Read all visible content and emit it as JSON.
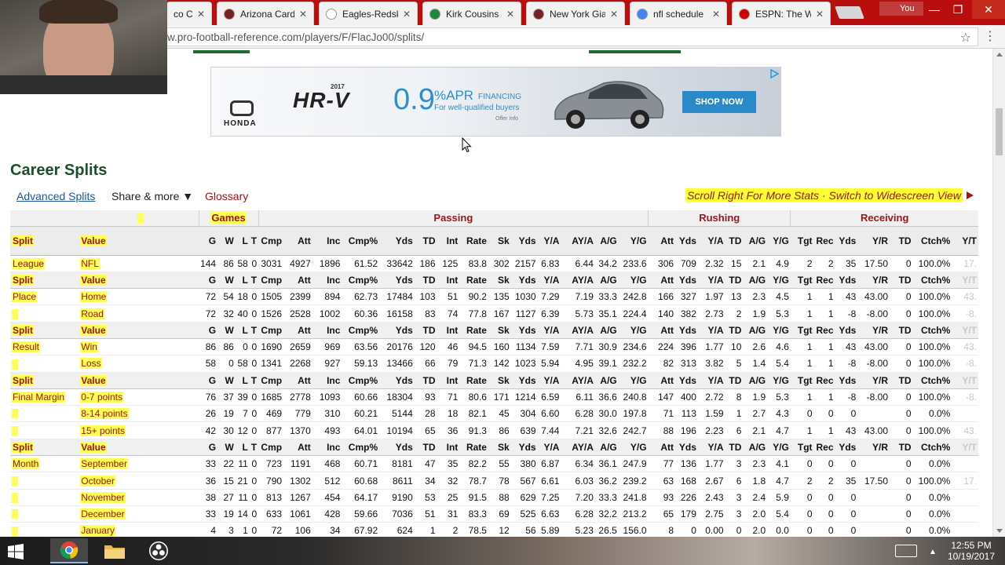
{
  "browser": {
    "tabs": [
      {
        "title": "co Ca",
        "favicon_color": "#8b5a2b"
      },
      {
        "title": "Arizona Card",
        "favicon_color": "#7a1f1f"
      },
      {
        "title": "Eagles-Redsk",
        "favicon_color": "#ffffff"
      },
      {
        "title": "Kirk Cousins",
        "favicon_color": "#1a8a3a"
      },
      {
        "title": "New York Gia",
        "favicon_color": "#7a1f1f"
      },
      {
        "title": "nfl schedule",
        "favicon_color": "#4285f4"
      },
      {
        "title": "ESPN: The W",
        "favicon_color": "#d00000"
      }
    ],
    "close_glyph": "✕",
    "user_label": "You",
    "url": "w.pro-football-reference.com/players/F/FlacJo00/splits/",
    "window_buttons": [
      "—",
      "❐",
      "✕"
    ]
  },
  "ad": {
    "brand": "HONDA",
    "year": "2017",
    "model": "HR-V",
    "rate": "0.9",
    "apr": "%APR",
    "financing": "FINANCING",
    "qualified": "For well-qualified buyers",
    "offer": "Offer Info",
    "cta": "SHOP NOW"
  },
  "page": {
    "title": "Career Splits",
    "advanced_link": "Advanced Splits",
    "share_menu": "Share & more ▼",
    "glossary": "Glossary",
    "scroll_hint": "Scroll Right For More Stats · Switch to Widescreen View"
  },
  "table": {
    "groups": [
      {
        "label": "",
        "span": 2
      },
      {
        "label": "Games",
        "span": 4
      },
      {
        "label": "Passing",
        "span": 14
      },
      {
        "label": "Rushing",
        "span": 6
      },
      {
        "label": "Receiving",
        "span": 8
      }
    ],
    "columns": [
      "Split",
      "Value",
      "G",
      "W",
      "L",
      "T",
      "Cmp",
      "Att",
      "Inc",
      "Cmp%",
      "Yds",
      "TD",
      "Int",
      "Rate",
      "Sk",
      "Yds",
      "Y/A",
      "AY/A",
      "A/G",
      "Y/G",
      "Att",
      "Yds",
      "Y/A",
      "TD",
      "A/G",
      "Y/G",
      "Tgt",
      "Rec",
      "Yds",
      "Y/R",
      "TD",
      "Ctch%",
      "Y/T"
    ],
    "rows": [
      {
        "type": "data",
        "split": "League",
        "value": "NFL",
        "cells": [
          "144",
          "86",
          "58",
          "0",
          "3031",
          "4927",
          "1896",
          "61.52",
          "33642",
          "186",
          "125",
          "83.8",
          "302",
          "2157",
          "6.83",
          "6.44",
          "34.2",
          "233.6",
          "306",
          "709",
          "2.32",
          "15",
          "2.1",
          "4.9",
          "2",
          "2",
          "35",
          "17.50",
          "0",
          "100.0%",
          "17."
        ]
      },
      {
        "type": "header"
      },
      {
        "type": "data",
        "split": "Place",
        "value": "Home",
        "cells": [
          "72",
          "54",
          "18",
          "0",
          "1505",
          "2399",
          "894",
          "62.73",
          "17484",
          "103",
          "51",
          "90.2",
          "135",
          "1030",
          "7.29",
          "7.19",
          "33.3",
          "242.8",
          "166",
          "327",
          "1.97",
          "13",
          "2.3",
          "4.5",
          "1",
          "1",
          "43",
          "43.00",
          "0",
          "100.0%",
          "43."
        ]
      },
      {
        "type": "data",
        "split": "",
        "value": "Road",
        "cells": [
          "72",
          "32",
          "40",
          "0",
          "1526",
          "2528",
          "1002",
          "60.36",
          "16158",
          "83",
          "74",
          "77.8",
          "167",
          "1127",
          "6.39",
          "5.73",
          "35.1",
          "224.4",
          "140",
          "382",
          "2.73",
          "2",
          "1.9",
          "5.3",
          "1",
          "1",
          "-8",
          "-8.00",
          "0",
          "100.0%",
          "-8."
        ]
      },
      {
        "type": "header"
      },
      {
        "type": "data",
        "split": "Result",
        "value": "Win",
        "cells": [
          "86",
          "86",
          "0",
          "0",
          "1690",
          "2659",
          "969",
          "63.56",
          "20176",
          "120",
          "46",
          "94.5",
          "160",
          "1134",
          "7.59",
          "7.71",
          "30.9",
          "234.6",
          "224",
          "396",
          "1.77",
          "10",
          "2.6",
          "4.6",
          "1",
          "1",
          "43",
          "43.00",
          "0",
          "100.0%",
          "43."
        ]
      },
      {
        "type": "data",
        "split": "",
        "value": "Loss",
        "cells": [
          "58",
          "0",
          "58",
          "0",
          "1341",
          "2268",
          "927",
          "59.13",
          "13466",
          "66",
          "79",
          "71.3",
          "142",
          "1023",
          "5.94",
          "4.95",
          "39.1",
          "232.2",
          "82",
          "313",
          "3.82",
          "5",
          "1.4",
          "5.4",
          "1",
          "1",
          "-8",
          "-8.00",
          "0",
          "100.0%",
          "-8."
        ]
      },
      {
        "type": "header"
      },
      {
        "type": "data",
        "split": "Final Margin",
        "value": "0-7 points",
        "cells": [
          "76",
          "37",
          "39",
          "0",
          "1685",
          "2778",
          "1093",
          "60.66",
          "18304",
          "93",
          "71",
          "80.6",
          "171",
          "1214",
          "6.59",
          "6.11",
          "36.6",
          "240.8",
          "147",
          "400",
          "2.72",
          "8",
          "1.9",
          "5.3",
          "1",
          "1",
          "-8",
          "-8.00",
          "0",
          "100.0%",
          "-8."
        ]
      },
      {
        "type": "data",
        "split": "",
        "value": "8-14 points",
        "cells": [
          "26",
          "19",
          "7",
          "0",
          "469",
          "779",
          "310",
          "60.21",
          "5144",
          "28",
          "18",
          "82.1",
          "45",
          "304",
          "6.60",
          "6.28",
          "30.0",
          "197.8",
          "71",
          "113",
          "1.59",
          "1",
          "2.7",
          "4.3",
          "0",
          "0",
          "0",
          "",
          "0",
          "0.0%",
          ""
        ]
      },
      {
        "type": "data",
        "split": "",
        "value": "15+ points",
        "cells": [
          "42",
          "30",
          "12",
          "0",
          "877",
          "1370",
          "493",
          "64.01",
          "10194",
          "65",
          "36",
          "91.3",
          "86",
          "639",
          "7.44",
          "7.21",
          "32.6",
          "242.7",
          "88",
          "196",
          "2.23",
          "6",
          "2.1",
          "4.7",
          "1",
          "1",
          "43",
          "43.00",
          "0",
          "100.0%",
          "43."
        ]
      },
      {
        "type": "header"
      },
      {
        "type": "data",
        "split": "Month",
        "value": "September",
        "cells": [
          "33",
          "22",
          "11",
          "0",
          "723",
          "1191",
          "468",
          "60.71",
          "8181",
          "47",
          "35",
          "82.2",
          "55",
          "380",
          "6.87",
          "6.34",
          "36.1",
          "247.9",
          "77",
          "136",
          "1.77",
          "3",
          "2.3",
          "4.1",
          "0",
          "0",
          "0",
          "",
          "0",
          "0.0%",
          ""
        ]
      },
      {
        "type": "data",
        "split": "",
        "value": "October",
        "cells": [
          "36",
          "15",
          "21",
          "0",
          "790",
          "1302",
          "512",
          "60.68",
          "8611",
          "34",
          "32",
          "78.7",
          "78",
          "567",
          "6.61",
          "6.03",
          "36.2",
          "239.2",
          "63",
          "168",
          "2.67",
          "6",
          "1.8",
          "4.7",
          "2",
          "2",
          "35",
          "17.50",
          "0",
          "100.0%",
          "17."
        ]
      },
      {
        "type": "data",
        "split": "",
        "value": "November",
        "cells": [
          "38",
          "27",
          "11",
          "0",
          "813",
          "1267",
          "454",
          "64.17",
          "9190",
          "53",
          "25",
          "91.5",
          "88",
          "629",
          "7.25",
          "7.20",
          "33.3",
          "241.8",
          "93",
          "226",
          "2.43",
          "3",
          "2.4",
          "5.9",
          "0",
          "0",
          "0",
          "",
          "0",
          "0.0%",
          ""
        ]
      },
      {
        "type": "data",
        "split": "",
        "value": "December",
        "cells": [
          "33",
          "19",
          "14",
          "0",
          "633",
          "1061",
          "428",
          "59.66",
          "7036",
          "51",
          "31",
          "83.3",
          "69",
          "525",
          "6.63",
          "6.28",
          "32.2",
          "213.2",
          "65",
          "179",
          "2.75",
          "3",
          "2.0",
          "5.4",
          "0",
          "0",
          "0",
          "",
          "0",
          "0.0%",
          ""
        ]
      },
      {
        "type": "data",
        "split": "",
        "value": "January",
        "cells": [
          "4",
          "3",
          "1",
          "0",
          "72",
          "106",
          "34",
          "67.92",
          "624",
          "1",
          "2",
          "78.5",
          "12",
          "56",
          "5.89",
          "5.23",
          "26.5",
          "156.0",
          "8",
          "0",
          "0.00",
          "0",
          "2.0",
          "0.0",
          "0",
          "0",
          "0",
          "",
          "0",
          "0.0%",
          ""
        ]
      }
    ]
  },
  "taskbar": {
    "time": "12:55 PM",
    "date": "10/19/2017"
  }
}
